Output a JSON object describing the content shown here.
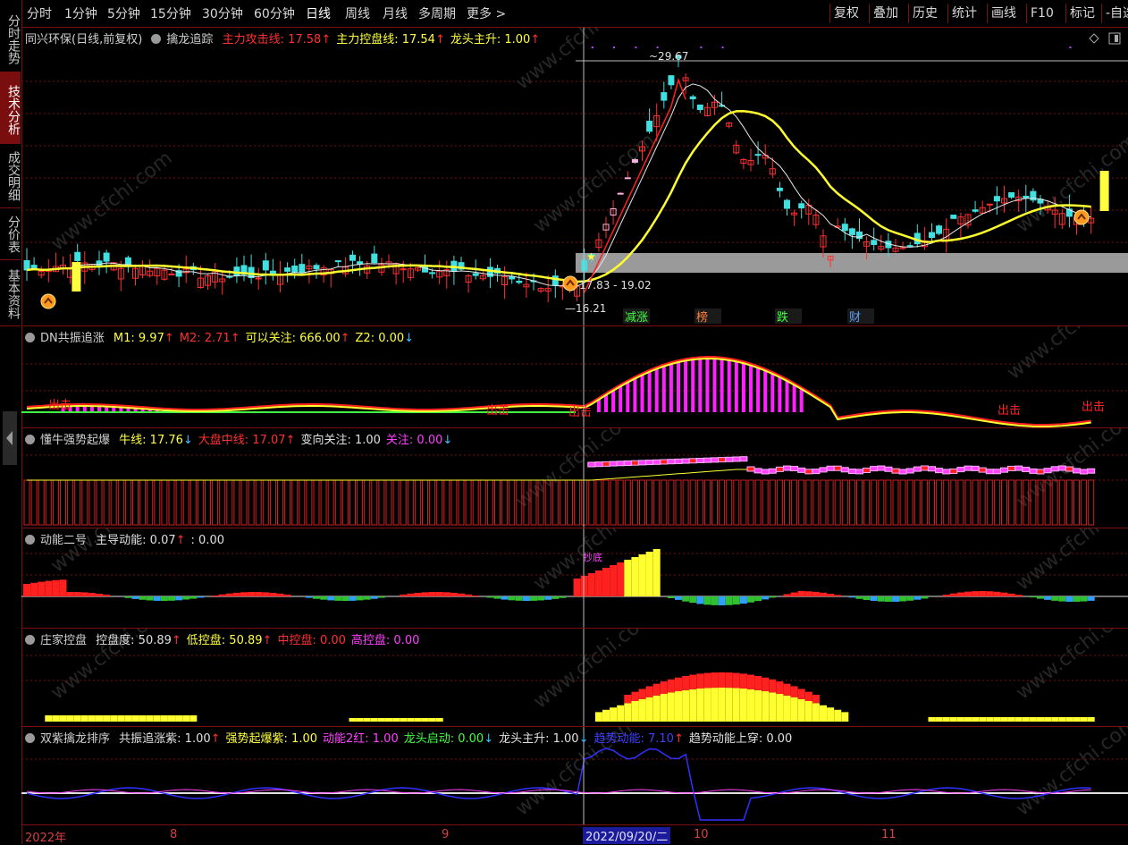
{
  "toolbar": {
    "periods": [
      "分时",
      "1分钟",
      "5分钟",
      "15分钟",
      "30分钟",
      "60分钟",
      "日线",
      "周线",
      "月线",
      "多周期",
      "更多 >"
    ],
    "active_period": "日线",
    "buttons": [
      "复权",
      "叠加",
      "历史",
      "统计",
      "画线",
      "F10",
      "标记",
      "-自选"
    ]
  },
  "left_tabs": [
    "分时走势",
    "技术分析",
    "成交明细",
    "分价表",
    "基本资料"
  ],
  "left_active": "技术分析",
  "main_chart": {
    "stock_title": "同兴环保(日线,前复权)",
    "indicator_name": "擒龙追踪",
    "legend": [
      {
        "label": "主力攻击线: 17.58",
        "color": "#ff3030",
        "arrow": "↑"
      },
      {
        "label": "主力控盘线: 17.54",
        "color": "#ffff40",
        "arrow": "↑"
      },
      {
        "label": "龙头主升: 1.00",
        "color": "#ffff40",
        "arrow": "↑"
      }
    ],
    "price_high_label": "29.67",
    "price_low_label": "16.21",
    "range_label": "17.83 - 19.02",
    "event_tags": [
      {
        "text": "减涨",
        "color": "#40ff40"
      },
      {
        "text": "榜",
        "color": "#ff8040"
      },
      {
        "text": "跌",
        "color": "#40ff40"
      },
      {
        "text": "财",
        "color": "#60a0ff"
      }
    ]
  },
  "pane_dn": {
    "name": "DN共振追涨",
    "legend": [
      {
        "label": "M1: 9.97",
        "color": "#ffff40",
        "arrow": "↑"
      },
      {
        "label": "M2: 2.71",
        "color": "#ff3030",
        "arrow": "↑"
      },
      {
        "label": "可以关注: 666.00",
        "color": "#ffff40",
        "arrow": "↑"
      },
      {
        "label": "Z2: 0.00",
        "color": "#ffff40",
        "arrow": "↓"
      }
    ],
    "marker_text": "出击"
  },
  "pane_dongniu": {
    "name": "懂牛强势起爆",
    "legend": [
      {
        "label": "牛线: 17.76",
        "color": "#ffff40",
        "arrow": "↓"
      },
      {
        "label": "大盘中线: 17.07",
        "color": "#ff3030",
        "arrow": "↑"
      },
      {
        "label": "变向关注: 1.00",
        "color": "#e0e0e0",
        "arrow": ""
      },
      {
        "label": "关注: 0.00",
        "color": "#ff40ff",
        "arrow": "↓"
      }
    ]
  },
  "pane_dongneng": {
    "name": "动能二号",
    "legend": [
      {
        "label": "主导动能: 0.07",
        "color": "#e0e0e0",
        "arrow": "↑"
      },
      {
        "label": ": 0.00",
        "color": "#e0e0e0",
        "arrow": ""
      }
    ],
    "marker_text": "抄底"
  },
  "pane_zhuangjia": {
    "name": "庄家控盘",
    "legend": [
      {
        "label": "控盘度: 50.89",
        "color": "#e0e0e0",
        "arrow": "↑"
      },
      {
        "label": "低控盘: 50.89",
        "color": "#ffff40",
        "arrow": "↑"
      },
      {
        "label": "中控盘: 0.00",
        "color": "#ff3030",
        "arrow": ""
      },
      {
        "label": "高控盘: 0.00",
        "color": "#ff40ff",
        "arrow": ""
      }
    ]
  },
  "pane_shuangzi": {
    "name": "双紫擒龙排序",
    "legend": [
      {
        "label": "共振追涨紫: 1.00",
        "color": "#e0e0e0",
        "arrow": "↑"
      },
      {
        "label": "强势起爆紫: 1.00",
        "color": "#ffff40",
        "arrow": ""
      },
      {
        "label": "动能2红: 1.00",
        "color": "#ff40ff",
        "arrow": ""
      },
      {
        "label": "龙头启动: 0.00",
        "color": "#40ff40",
        "arrow": "↓"
      },
      {
        "label": "龙头主升: 1.00",
        "color": "#e0e0e0",
        "arrow": "↓"
      },
      {
        "label": "趋势动能: 7.10",
        "color": "#4040ff",
        "arrow": "↑"
      },
      {
        "label": "趋势动能上穿: 0.00",
        "color": "#e0e0e0",
        "arrow": ""
      }
    ]
  },
  "dates": [
    "2022年",
    "8",
    "9",
    "10",
    "11"
  ],
  "current_date": "2022/09/20/二",
  "watermark": "www.cfchi.com"
}
